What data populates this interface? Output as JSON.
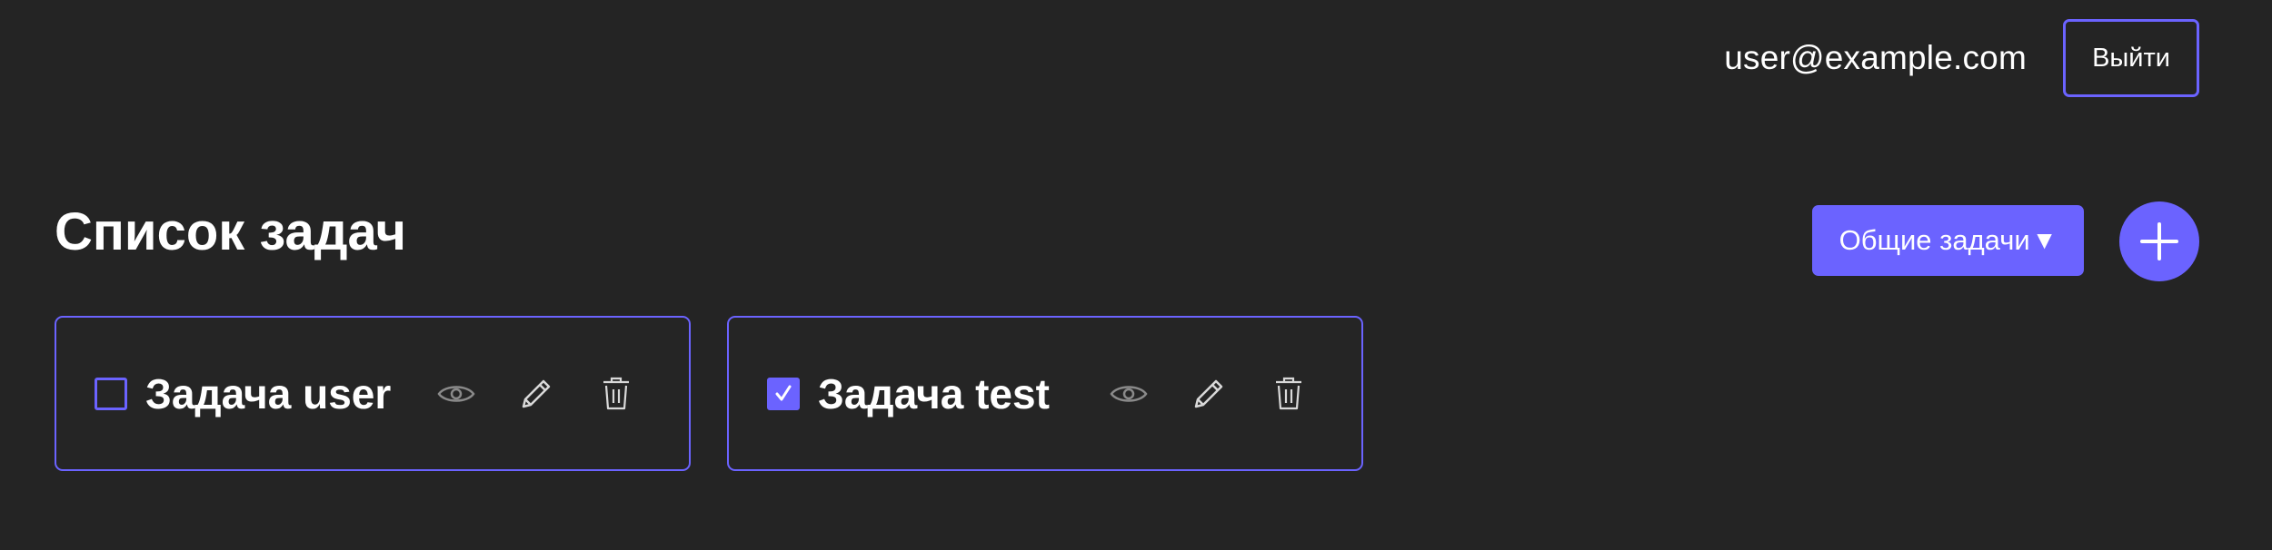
{
  "header": {
    "user_email": "user@example.com",
    "logout_label": "Выйти"
  },
  "page": {
    "title": "Список задач"
  },
  "filter": {
    "selected": "Общие задачи",
    "caret": "▼"
  },
  "add_button": {
    "icon": "plus-icon"
  },
  "tasks": [
    {
      "title": "Задача user",
      "completed": false
    },
    {
      "title": "Задача test",
      "completed": true
    }
  ],
  "colors": {
    "background": "#242424",
    "accent": "#6b63ff",
    "text": "#ffffff",
    "icon_muted": "#8a8a8a",
    "icon": "#d9d9d9"
  },
  "icons": [
    "eye-icon",
    "pencil-icon",
    "trash-icon"
  ]
}
